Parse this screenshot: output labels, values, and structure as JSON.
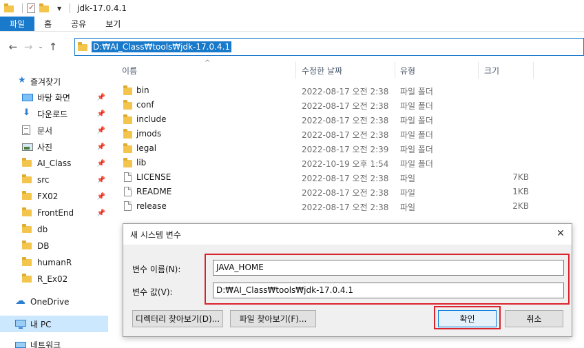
{
  "window": {
    "title": "jdk-17.0.4.1"
  },
  "ribbon": {
    "tabs": [
      "파일",
      "홈",
      "공유",
      "보기"
    ]
  },
  "address": {
    "path": "D:₩AI_Class₩tools₩jdk-17.0.4.1"
  },
  "columns": {
    "name": "이름",
    "date": "수정한 날짜",
    "type": "유형",
    "size": "크기"
  },
  "files": [
    {
      "name": "bin",
      "date": "2022-08-17 오전 2:38",
      "type": "파일 폴더",
      "size": "",
      "kind": "folder"
    },
    {
      "name": "conf",
      "date": "2022-08-17 오전 2:38",
      "type": "파일 폴더",
      "size": "",
      "kind": "folder"
    },
    {
      "name": "include",
      "date": "2022-08-17 오전 2:38",
      "type": "파일 폴더",
      "size": "",
      "kind": "folder"
    },
    {
      "name": "jmods",
      "date": "2022-08-17 오전 2:38",
      "type": "파일 폴더",
      "size": "",
      "kind": "folder"
    },
    {
      "name": "legal",
      "date": "2022-08-17 오전 2:39",
      "type": "파일 폴더",
      "size": "",
      "kind": "folder"
    },
    {
      "name": "lib",
      "date": "2022-10-19 오후 1:54",
      "type": "파일 폴더",
      "size": "",
      "kind": "folder"
    },
    {
      "name": "LICENSE",
      "date": "2022-08-17 오전 2:38",
      "type": "파일",
      "size": "7KB",
      "kind": "file"
    },
    {
      "name": "README",
      "date": "2022-08-17 오전 2:38",
      "type": "파일",
      "size": "1KB",
      "kind": "file"
    },
    {
      "name": "release",
      "date": "2022-08-17 오전 2:38",
      "type": "파일",
      "size": "2KB",
      "kind": "file"
    }
  ],
  "sidebar": {
    "items": [
      {
        "label": "즐겨찾기",
        "icon": "star-icon",
        "pinned": false
      },
      {
        "label": "바탕 화면",
        "icon": "desktop-icon",
        "pinned": true
      },
      {
        "label": "다운로드",
        "icon": "download-icon",
        "pinned": true
      },
      {
        "label": "문서",
        "icon": "document-icon",
        "pinned": true
      },
      {
        "label": "사진",
        "icon": "picture-icon",
        "pinned": true
      },
      {
        "label": "AI_Class",
        "icon": "folder-icon",
        "pinned": true
      },
      {
        "label": "src",
        "icon": "folder-icon",
        "pinned": true
      },
      {
        "label": "FX02",
        "icon": "folder-icon",
        "pinned": true
      },
      {
        "label": "FrontEnd",
        "icon": "folder-icon",
        "pinned": true
      },
      {
        "label": "db",
        "icon": "folder-icon",
        "pinned": false
      },
      {
        "label": "DB",
        "icon": "folder-icon",
        "pinned": false
      },
      {
        "label": "humanR",
        "icon": "folder-icon",
        "pinned": false
      },
      {
        "label": "R_Ex02",
        "icon": "folder-icon",
        "pinned": false
      },
      {
        "label": "OneDrive",
        "icon": "cloud-icon",
        "pinned": false
      },
      {
        "label": "내 PC",
        "icon": "pc-icon",
        "pinned": false
      },
      {
        "label": "네트워크",
        "icon": "network-icon",
        "pinned": false
      }
    ]
  },
  "dialog": {
    "title": "새 시스템 변수",
    "var_name_label": "변수 이름(N):",
    "var_name_value": "JAVA_HOME",
    "var_value_label": "변수 값(V):",
    "var_value_value": "D:₩AI_Class₩tools₩jdk-17.0.4.1",
    "browse_dir_label": "디렉터리 찾아보기(D)...",
    "browse_file_label": "파일 찾아보기(F)...",
    "ok_label": "확인",
    "cancel_label": "취소",
    "highlight_color": "#d9232d"
  }
}
